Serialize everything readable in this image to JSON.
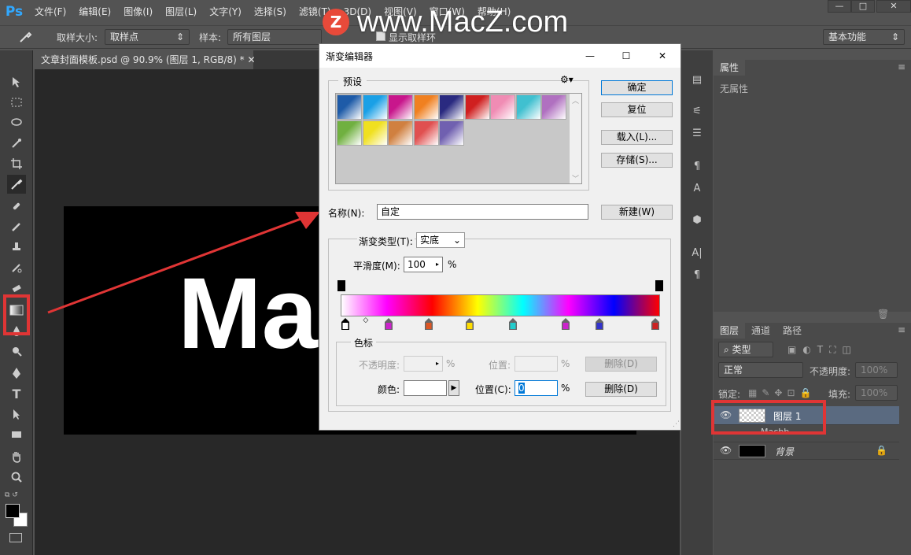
{
  "app": {
    "logo": "Ps"
  },
  "menu": [
    "文件(F)",
    "编辑(E)",
    "图像(I)",
    "图层(L)",
    "文字(Y)",
    "选择(S)",
    "滤镜(T)",
    "3D(D)",
    "视图(V)",
    "窗口(W)",
    "帮助(H)"
  ],
  "watermark": {
    "logo_letter": "Z",
    "text": "www.MacZ.com"
  },
  "options": {
    "sample_size_label": "取样大小:",
    "sample_size_value": "取样点",
    "sample_label": "样本:",
    "sample_value": "所有图层",
    "show_ring_label": "显示取样环",
    "workspace": "基本功能"
  },
  "document": {
    "tab_title": "文章封面模板.psd @ 90.9% (图层 1, RGB/8) *",
    "canvas_text": "Ma"
  },
  "dialog": {
    "title": "渐变编辑器",
    "presets_label": "预设",
    "buttons": {
      "ok": "确定",
      "reset": "复位",
      "load": "载入(L)...",
      "save": "存储(S)...",
      "new": "新建(W)"
    },
    "name_label": "名称(N):",
    "name_value": "自定",
    "gradient_type_label": "渐变类型(T):",
    "gradient_type_value": "实底",
    "smoothness_label": "平滑度(M):",
    "smoothness_value": "100",
    "percent": "%",
    "stops_label": "色标",
    "opacity_label": "不透明度:",
    "position_label_disabled": "位置:",
    "delete_label_disabled": "删除(D)",
    "color_label": "颜色:",
    "position_label": "位置(C):",
    "position_value": "0",
    "delete_label": "删除(D)",
    "presets": [
      [
        "#1e5ba8",
        "#ffffff"
      ],
      [
        "#1aa0e6",
        "#ffffff"
      ],
      [
        "#c8168c",
        "#ffffff"
      ],
      [
        "#f08020",
        "#ffffff"
      ],
      [
        "#2a2a80",
        "#ffffff"
      ],
      [
        "#d02020",
        "#ffffff"
      ],
      [
        "#f08cb4",
        "#ffffff"
      ],
      [
        "#40c0d0",
        "#ffffff"
      ],
      [
        "#b070c0",
        "#ffffff"
      ],
      [
        "#70b040",
        "#ffffff"
      ],
      [
        "#f0e020",
        "#ffffff"
      ],
      [
        "#d08040",
        "#ffffff"
      ],
      [
        "#e05050",
        "#ffffff"
      ],
      [
        "#7060b0",
        "#ffffff"
      ]
    ],
    "gradient_colors": [
      "#ffffff",
      "#ff00ff",
      "#ff0000",
      "#ffff00",
      "#00ffff",
      "#ff00ff",
      "#0000ff",
      "#ff0000"
    ],
    "color_stops": [
      {
        "pos": 0,
        "color": "#ffffff",
        "selected": true
      },
      {
        "pos": 0.14,
        "color": "#cc22cc"
      },
      {
        "pos": 0.27,
        "color": "#dd5522"
      },
      {
        "pos": 0.4,
        "color": "#ffdd00"
      },
      {
        "pos": 0.54,
        "color": "#22cccc"
      },
      {
        "pos": 0.71,
        "color": "#cc22cc"
      },
      {
        "pos": 0.82,
        "color": "#3333cc"
      },
      {
        "pos": 1.0,
        "color": "#cc2222"
      }
    ],
    "midpoint": 0.07,
    "opacity_stops": [
      0,
      1
    ]
  },
  "panels": {
    "properties": {
      "tab": "属性",
      "content": "无属性"
    },
    "layers": {
      "tabs": [
        "图层",
        "通道",
        "路径"
      ],
      "filter": "类型",
      "blend_mode": "正常",
      "opacity_label": "不透明度:",
      "opacity_value": "100%",
      "lock_label": "锁定:",
      "fill_label": "填充:",
      "fill_value": "100%",
      "items": [
        {
          "name": "图层 1",
          "thumb": "transparent"
        },
        {
          "name": "Macbb",
          "thumb": "text"
        },
        {
          "name": "背景",
          "thumb": "#000000"
        }
      ]
    }
  }
}
